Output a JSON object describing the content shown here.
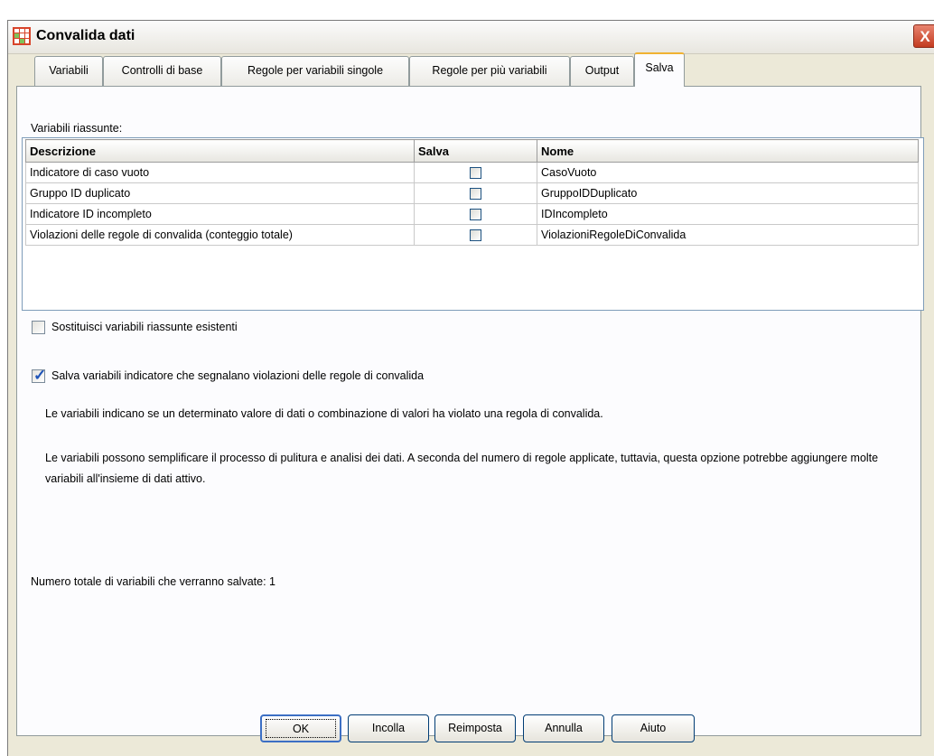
{
  "window": {
    "title": "Convalida dati",
    "close_label": "X"
  },
  "tabs": [
    {
      "label": "Variabili"
    },
    {
      "label": "Controlli di base"
    },
    {
      "label": "Regole per variabili singole"
    },
    {
      "label": "Regole per più variabili"
    },
    {
      "label": "Output"
    },
    {
      "label": "Salva",
      "active": true
    }
  ],
  "summary": {
    "label": "Variabili riassunte:",
    "columns": [
      "Descrizione",
      "Salva",
      "Nome"
    ],
    "rows": [
      {
        "descrizione": "Indicatore di caso vuoto",
        "salva": false,
        "nome": "CasoVuoto"
      },
      {
        "descrizione": "Gruppo ID duplicato",
        "salva": false,
        "nome": "GruppoIDDuplicato"
      },
      {
        "descrizione": "Indicatore ID incompleto",
        "salva": false,
        "nome": "IDIncompleto"
      },
      {
        "descrizione": "Violazioni delle regole di convalida (conteggio totale)",
        "salva": false,
        "nome": "ViolazioniRegoleDiConvalida"
      }
    ]
  },
  "options": {
    "replace_label": "Sostituisci variabili riassunte esistenti",
    "replace_checked": false,
    "save_indicator_label": "Salva variabili indicatore che segnalano violazioni delle regole di convalida",
    "save_indicator_checked": true,
    "info1": "Le variabili indicano se un determinato valore di dati o combinazione di valori ha violato una regola di convalida.",
    "info2": "Le variabili possono semplificare il processo di pulitura e analisi dei dati. A seconda del numero di regole applicate, tuttavia, questa opzione potrebbe aggiungere molte variabili all'insieme di dati attivo.",
    "total": "Numero totale di variabili che verranno salvate:  1"
  },
  "buttons": {
    "ok": "OK",
    "paste": "Incolla",
    "reset": "Reimposta",
    "cancel": "Annulla",
    "help": "Aiuto"
  }
}
